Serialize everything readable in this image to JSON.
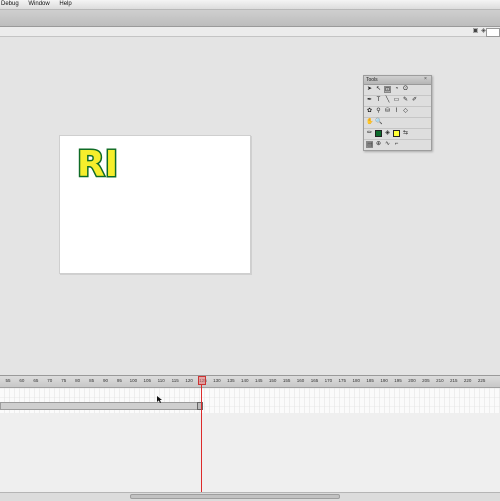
{
  "menubar": {
    "items": [
      "Debug",
      "Window",
      "Help"
    ]
  },
  "tools_panel": {
    "title": "Tools",
    "stroke_color": "#0d6b2c",
    "fill_color": "#ffff33"
  },
  "stage": {
    "artwork_text": "RI",
    "text_fill": "#f6ee2c",
    "text_stroke": "#0f6b26"
  },
  "timeline": {
    "ruler_labels": [
      "55",
      "60",
      "65",
      "70",
      "75",
      "80",
      "85",
      "90",
      "95",
      "100",
      "105",
      "110",
      "115",
      "120",
      "125",
      "130",
      "135",
      "140",
      "145",
      "150",
      "155",
      "160",
      "165",
      "170",
      "175",
      "180",
      "185",
      "190",
      "195",
      "200",
      "205",
      "210",
      "215",
      "220",
      "225"
    ],
    "current_frame": "120",
    "playhead_color": "#dd2b2b",
    "tween_color": "#c9c0ef"
  },
  "colors": {
    "workspace": "#e4e4e4",
    "stage_bg": "#ffffff"
  }
}
